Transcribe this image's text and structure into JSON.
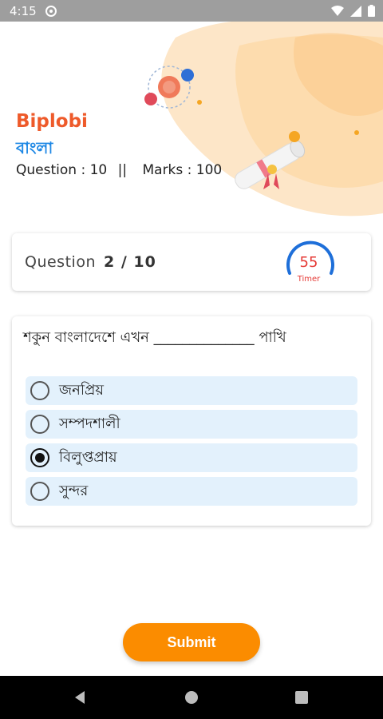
{
  "status_bar": {
    "time": "4:15"
  },
  "quiz": {
    "title": "Biplobi",
    "subject": "বাংলা",
    "question_total": "Question : 10",
    "separator": "||",
    "marks": "Marks : 100"
  },
  "progress": {
    "label": "Question",
    "current": "2 / 10",
    "timer_value": "55",
    "timer_label": "Timer"
  },
  "question": {
    "text": "শকুন বাংলাদেশে এখন ______________ পাখি",
    "options": [
      {
        "label": "জনপ্রিয়",
        "selected": false
      },
      {
        "label": "সম্পদশালী",
        "selected": false
      },
      {
        "label": "বিলুপ্তপ্রায়",
        "selected": true
      },
      {
        "label": "সুন্দর",
        "selected": false
      }
    ]
  },
  "submit_label": "Submit",
  "colors": {
    "accent": "#fb8c00",
    "title": "#ee5a2a",
    "subject": "#1e88e5",
    "option_bg": "#e3f1fc",
    "timer": "#e53935"
  }
}
